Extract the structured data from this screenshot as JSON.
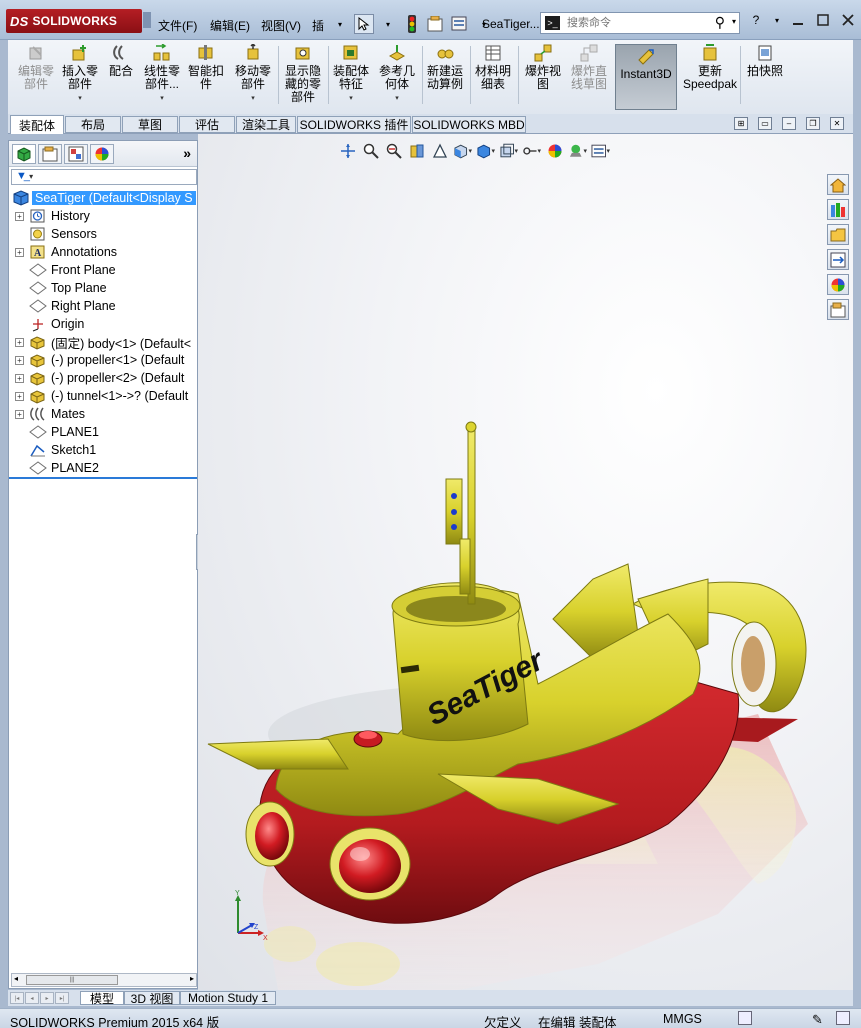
{
  "app": {
    "logo_text": "SOLIDWORKS",
    "doc_title": "SeaTiger...",
    "menus": [
      "文件(F)",
      "编辑(E)",
      "视图(V)",
      "插"
    ],
    "search_placeholder": "搜索命令",
    "help_label": "?"
  },
  "command_manager": {
    "buttons": [
      {
        "label": "编辑零\n部件",
        "icon": "edit-component-icon",
        "disabled": true,
        "arrow": false
      },
      {
        "label": "插入零\n部件",
        "icon": "insert-component-icon",
        "disabled": false,
        "arrow": true
      },
      {
        "label": "配合",
        "icon": "mate-icon",
        "disabled": false,
        "arrow": false
      },
      {
        "label": "线性零\n部件...",
        "icon": "linear-pattern-icon",
        "disabled": false,
        "arrow": true
      },
      {
        "label": "智能扣\n件",
        "icon": "smart-fasteners-icon",
        "disabled": false,
        "arrow": false
      },
      {
        "label": "移动零\n部件",
        "icon": "move-component-icon",
        "disabled": false,
        "arrow": true
      },
      {
        "label": "显示隐\n藏的零\n部件",
        "icon": "show-hidden-components-icon",
        "disabled": false,
        "arrow": false
      },
      {
        "label": "装配体\n特征",
        "icon": "assembly-features-icon",
        "disabled": false,
        "arrow": true
      },
      {
        "label": "参考几\n何体",
        "icon": "reference-geometry-icon",
        "disabled": false,
        "arrow": true
      },
      {
        "label": "新建运\n动算例",
        "icon": "new-motion-study-icon",
        "disabled": false,
        "arrow": false
      },
      {
        "label": "材料明\n细表",
        "icon": "bill-of-materials-icon",
        "disabled": false,
        "arrow": false
      },
      {
        "label": "爆炸视\n图",
        "icon": "exploded-view-icon",
        "disabled": false,
        "arrow": false
      },
      {
        "label": "爆炸直\n线草图",
        "icon": "explode-line-sketch-icon",
        "disabled": true,
        "arrow": false
      },
      {
        "label": "Instant3D",
        "icon": "instant3d-icon",
        "disabled": false,
        "arrow": false,
        "pressed": true
      },
      {
        "label": "更新\nSpeedpak",
        "icon": "update-speedpak-icon",
        "disabled": false,
        "arrow": false
      },
      {
        "label": "拍快照",
        "icon": "take-snapshot-icon",
        "disabled": false,
        "arrow": false
      }
    ]
  },
  "tabs": [
    "装配体",
    "布局",
    "草图",
    "评估",
    "渲染工具",
    "SOLIDWORKS 插件",
    "SOLIDWORKS MBD"
  ],
  "active_tab": "装配体",
  "feature_tree": {
    "root": "SeaTiger  (Default<Display S",
    "nodes": [
      {
        "label": "History",
        "icon": "history-icon",
        "expand": true
      },
      {
        "label": "Sensors",
        "icon": "sensors-icon",
        "expand": false
      },
      {
        "label": "Annotations",
        "icon": "annotations-icon",
        "expand": true
      },
      {
        "label": "Front Plane",
        "icon": "plane-icon",
        "expand": false
      },
      {
        "label": "Top Plane",
        "icon": "plane-icon",
        "expand": false
      },
      {
        "label": "Right Plane",
        "icon": "plane-icon",
        "expand": false
      },
      {
        "label": "Origin",
        "icon": "origin-icon",
        "expand": false
      },
      {
        "label": "(固定) body<1> (Default<",
        "icon": "part-icon",
        "expand": true
      },
      {
        "label": "(-) propeller<1> (Default",
        "icon": "part-icon",
        "expand": true
      },
      {
        "label": "(-) propeller<2> (Default",
        "icon": "part-icon",
        "expand": true
      },
      {
        "label": "(-) tunnel<1>->? (Default",
        "icon": "part-icon",
        "expand": true
      },
      {
        "label": "Mates",
        "icon": "mates-icon",
        "expand": true
      },
      {
        "label": "PLANE1",
        "icon": "plane-icon",
        "expand": false
      },
      {
        "label": "Sketch1",
        "icon": "sketch-icon",
        "expand": false
      },
      {
        "label": "PLANE2",
        "icon": "plane-icon",
        "expand": false
      }
    ]
  },
  "model": {
    "brand_text": "SeaTiger",
    "hull_color": "#b41b1f",
    "deck_color": "#d8d12c"
  },
  "bottom_tabs": [
    "模型",
    "3D 视图",
    "Motion Study 1"
  ],
  "active_bottom_tab": "模型",
  "status": {
    "product": "SOLIDWORKS Premium 2015 x64 版",
    "definition": "欠定义",
    "mode": "在编辑 装配体",
    "units": "MMGS"
  },
  "colors": {
    "accent": "#3399ff",
    "title_bg": "#b9cbe0",
    "logo_red": "#a01820"
  }
}
